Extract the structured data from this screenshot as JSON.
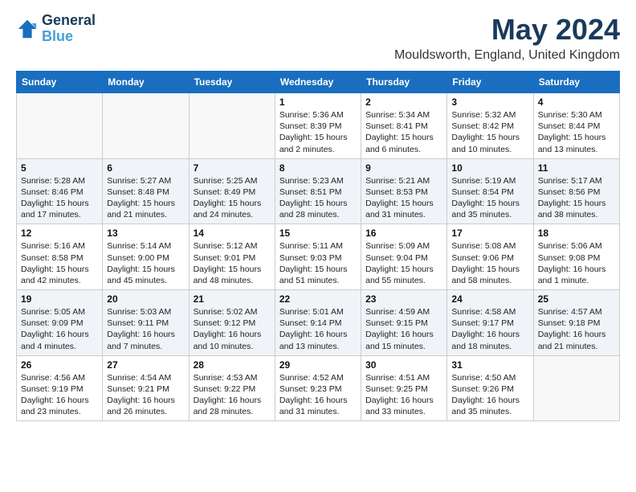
{
  "header": {
    "logo_line1": "General",
    "logo_line2": "Blue",
    "title": "May 2024",
    "subtitle": "Mouldsworth, England, United Kingdom"
  },
  "weekdays": [
    "Sunday",
    "Monday",
    "Tuesday",
    "Wednesday",
    "Thursday",
    "Friday",
    "Saturday"
  ],
  "weeks": [
    [
      {
        "day": "",
        "info": ""
      },
      {
        "day": "",
        "info": ""
      },
      {
        "day": "",
        "info": ""
      },
      {
        "day": "1",
        "info": "Sunrise: 5:36 AM\nSunset: 8:39 PM\nDaylight: 15 hours and 2 minutes."
      },
      {
        "day": "2",
        "info": "Sunrise: 5:34 AM\nSunset: 8:41 PM\nDaylight: 15 hours and 6 minutes."
      },
      {
        "day": "3",
        "info": "Sunrise: 5:32 AM\nSunset: 8:42 PM\nDaylight: 15 hours and 10 minutes."
      },
      {
        "day": "4",
        "info": "Sunrise: 5:30 AM\nSunset: 8:44 PM\nDaylight: 15 hours and 13 minutes."
      }
    ],
    [
      {
        "day": "5",
        "info": "Sunrise: 5:28 AM\nSunset: 8:46 PM\nDaylight: 15 hours and 17 minutes."
      },
      {
        "day": "6",
        "info": "Sunrise: 5:27 AM\nSunset: 8:48 PM\nDaylight: 15 hours and 21 minutes."
      },
      {
        "day": "7",
        "info": "Sunrise: 5:25 AM\nSunset: 8:49 PM\nDaylight: 15 hours and 24 minutes."
      },
      {
        "day": "8",
        "info": "Sunrise: 5:23 AM\nSunset: 8:51 PM\nDaylight: 15 hours and 28 minutes."
      },
      {
        "day": "9",
        "info": "Sunrise: 5:21 AM\nSunset: 8:53 PM\nDaylight: 15 hours and 31 minutes."
      },
      {
        "day": "10",
        "info": "Sunrise: 5:19 AM\nSunset: 8:54 PM\nDaylight: 15 hours and 35 minutes."
      },
      {
        "day": "11",
        "info": "Sunrise: 5:17 AM\nSunset: 8:56 PM\nDaylight: 15 hours and 38 minutes."
      }
    ],
    [
      {
        "day": "12",
        "info": "Sunrise: 5:16 AM\nSunset: 8:58 PM\nDaylight: 15 hours and 42 minutes."
      },
      {
        "day": "13",
        "info": "Sunrise: 5:14 AM\nSunset: 9:00 PM\nDaylight: 15 hours and 45 minutes."
      },
      {
        "day": "14",
        "info": "Sunrise: 5:12 AM\nSunset: 9:01 PM\nDaylight: 15 hours and 48 minutes."
      },
      {
        "day": "15",
        "info": "Sunrise: 5:11 AM\nSunset: 9:03 PM\nDaylight: 15 hours and 51 minutes."
      },
      {
        "day": "16",
        "info": "Sunrise: 5:09 AM\nSunset: 9:04 PM\nDaylight: 15 hours and 55 minutes."
      },
      {
        "day": "17",
        "info": "Sunrise: 5:08 AM\nSunset: 9:06 PM\nDaylight: 15 hours and 58 minutes."
      },
      {
        "day": "18",
        "info": "Sunrise: 5:06 AM\nSunset: 9:08 PM\nDaylight: 16 hours and 1 minute."
      }
    ],
    [
      {
        "day": "19",
        "info": "Sunrise: 5:05 AM\nSunset: 9:09 PM\nDaylight: 16 hours and 4 minutes."
      },
      {
        "day": "20",
        "info": "Sunrise: 5:03 AM\nSunset: 9:11 PM\nDaylight: 16 hours and 7 minutes."
      },
      {
        "day": "21",
        "info": "Sunrise: 5:02 AM\nSunset: 9:12 PM\nDaylight: 16 hours and 10 minutes."
      },
      {
        "day": "22",
        "info": "Sunrise: 5:01 AM\nSunset: 9:14 PM\nDaylight: 16 hours and 13 minutes."
      },
      {
        "day": "23",
        "info": "Sunrise: 4:59 AM\nSunset: 9:15 PM\nDaylight: 16 hours and 15 minutes."
      },
      {
        "day": "24",
        "info": "Sunrise: 4:58 AM\nSunset: 9:17 PM\nDaylight: 16 hours and 18 minutes."
      },
      {
        "day": "25",
        "info": "Sunrise: 4:57 AM\nSunset: 9:18 PM\nDaylight: 16 hours and 21 minutes."
      }
    ],
    [
      {
        "day": "26",
        "info": "Sunrise: 4:56 AM\nSunset: 9:19 PM\nDaylight: 16 hours and 23 minutes."
      },
      {
        "day": "27",
        "info": "Sunrise: 4:54 AM\nSunset: 9:21 PM\nDaylight: 16 hours and 26 minutes."
      },
      {
        "day": "28",
        "info": "Sunrise: 4:53 AM\nSunset: 9:22 PM\nDaylight: 16 hours and 28 minutes."
      },
      {
        "day": "29",
        "info": "Sunrise: 4:52 AM\nSunset: 9:23 PM\nDaylight: 16 hours and 31 minutes."
      },
      {
        "day": "30",
        "info": "Sunrise: 4:51 AM\nSunset: 9:25 PM\nDaylight: 16 hours and 33 minutes."
      },
      {
        "day": "31",
        "info": "Sunrise: 4:50 AM\nSunset: 9:26 PM\nDaylight: 16 hours and 35 minutes."
      },
      {
        "day": "",
        "info": ""
      }
    ]
  ]
}
